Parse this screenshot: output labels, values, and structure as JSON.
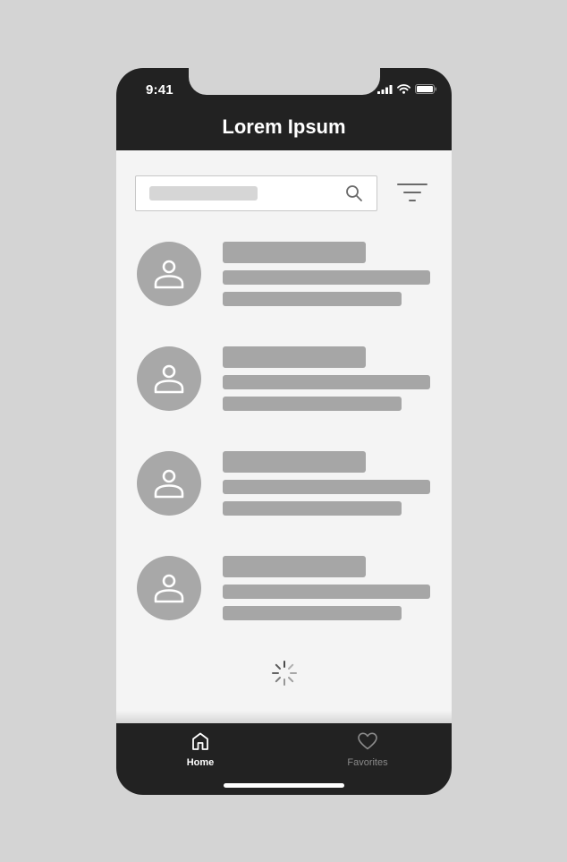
{
  "status_bar": {
    "time": "9:41"
  },
  "header": {
    "title": "Lorem Ipsum"
  },
  "search": {
    "icon": "search-icon",
    "filter_icon": "filter-icon"
  },
  "list": {
    "items": [
      {
        "avatar_icon": "user-icon"
      },
      {
        "avatar_icon": "user-icon"
      },
      {
        "avatar_icon": "user-icon"
      },
      {
        "avatar_icon": "user-icon"
      }
    ],
    "loading_icon": "loading-spinner-icon"
  },
  "tabbar": {
    "tabs": [
      {
        "label": "Home",
        "icon": "home-icon",
        "active": true
      },
      {
        "label": "Favorites",
        "icon": "heart-icon",
        "active": false
      }
    ]
  },
  "colors": {
    "background": "#d4d4d4",
    "header": "#222222",
    "content": "#f4f4f4",
    "placeholder": "#a6a6a6",
    "active_tab": "#ffffff",
    "inactive_tab": "#8a8a8a"
  }
}
